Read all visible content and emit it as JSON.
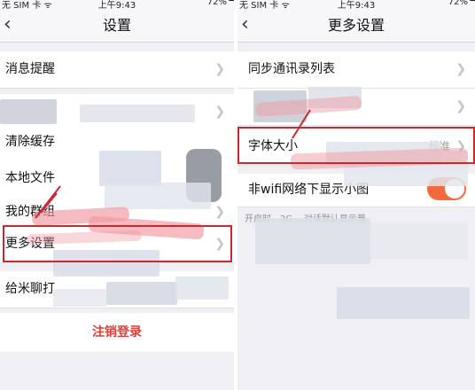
{
  "left_screen": {
    "status": {
      "carrier": "无 SIM 卡 ᯤ",
      "time": "上午9:43",
      "battery": "72%"
    },
    "nav": {
      "title": "设置"
    },
    "items": [
      {
        "label": "消息提醒"
      },
      {
        "label": ""
      },
      {
        "label": "清除缓存"
      },
      {
        "label": "本地文件"
      },
      {
        "label": "我的群组"
      },
      {
        "label": "更多设置"
      },
      {
        "label": "给米聊打"
      }
    ],
    "logout_label": "注销登录"
  },
  "right_screen": {
    "status": {
      "carrier": "无 SIM 卡 ᯤ",
      "time": "上午9:43",
      "battery": "72%"
    },
    "nav": {
      "title": "更多设置"
    },
    "items": [
      {
        "label": "同步通讯录列表"
      },
      {
        "label": ""
      },
      {
        "label": "字体大小",
        "value": "标准"
      },
      {
        "label": "非wifi网络下显示小图",
        "toggle_on": true
      }
    ],
    "note": "开启时，2G         ...对话默认显示普"
  },
  "colors": {
    "accent_red": "#c9282e",
    "logout_red": "#e53935",
    "toggle_orange": "#f46a3c"
  },
  "icons": {
    "back": "chevron-left-icon",
    "disclosure": "chevron-right-icon"
  }
}
